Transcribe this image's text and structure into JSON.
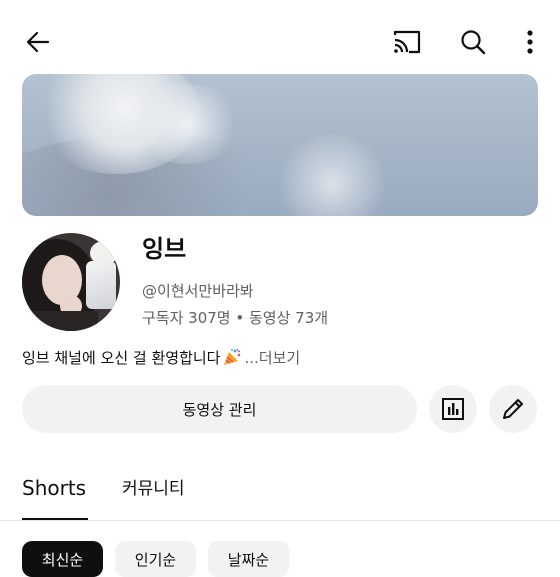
{
  "topbar": {
    "back_icon": "arrow-left-icon",
    "cast_icon": "cast-icon",
    "search_icon": "search-icon",
    "more_icon": "more-vertical-icon"
  },
  "channel": {
    "name": "잉브",
    "handle": "@이현서만바라봐",
    "stats": "구독자 307명 • 동영상 73개",
    "description": "잉브 채널에 오신 걸 환영합니다",
    "description_more": "...더보기"
  },
  "actions": {
    "manage_label": "동영상 관리",
    "analytics_icon": "bar-chart-icon",
    "edit_icon": "pencil-icon"
  },
  "tabs": [
    {
      "label": "Shorts",
      "selected": true
    },
    {
      "label": "커뮤니티",
      "selected": false
    }
  ],
  "chips": [
    {
      "label": "최신순",
      "selected": true
    },
    {
      "label": "인기순",
      "selected": false
    },
    {
      "label": "날짜순",
      "selected": false
    }
  ],
  "colors": {
    "text": "#0f0f0f",
    "secondary": "#606060",
    "chip_bg": "#f2f2f2"
  }
}
